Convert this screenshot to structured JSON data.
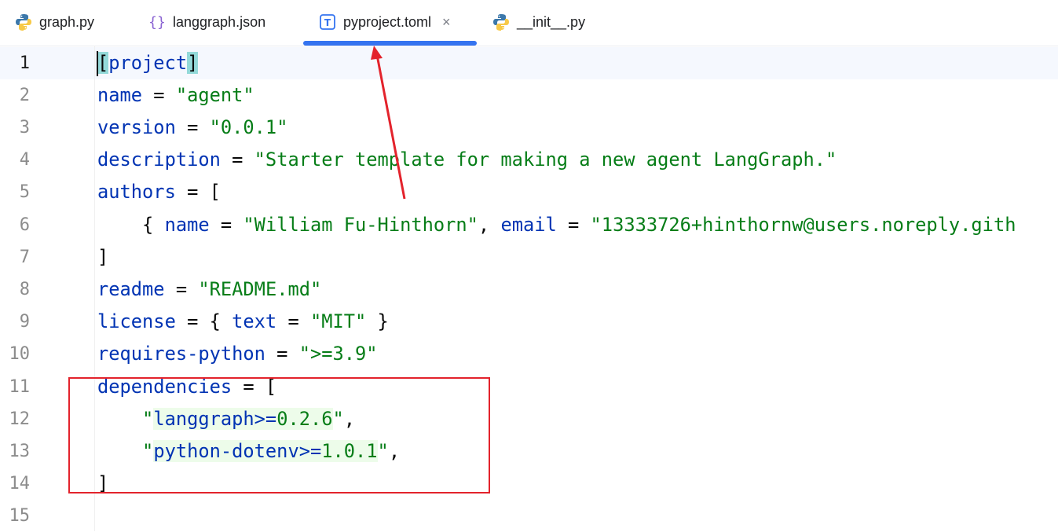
{
  "tabs": [
    {
      "label": "graph.py",
      "icon": "python-icon"
    },
    {
      "label": "langgraph.json",
      "icon": "json-braces-icon"
    },
    {
      "label": "pyproject.toml",
      "icon": "toml-file-icon",
      "active": true
    },
    {
      "label": "__init__.py",
      "icon": "python-icon"
    }
  ],
  "tab_close": "×",
  "colors": {
    "accent": "#3574f0",
    "keyword": "#0033b3",
    "string": "#067d17",
    "annotation": "#e3232c",
    "dependency_highlight": "#edfcea",
    "bracket_match": "#93d9d9"
  },
  "editor": {
    "line_numbers": [
      "1",
      "2",
      "3",
      "4",
      "5",
      "6",
      "7",
      "8",
      "9",
      "10",
      "11",
      "12",
      "13",
      "14",
      "15"
    ],
    "lines": [
      [
        {
          "t": "[",
          "c": "p hl-b"
        },
        {
          "t": "project",
          "c": "k"
        },
        {
          "t": "]",
          "c": "p hl-b"
        }
      ],
      [
        {
          "t": "name",
          "c": "k"
        },
        {
          "t": " = ",
          "c": "p"
        },
        {
          "t": "\"agent\"",
          "c": "s"
        }
      ],
      [
        {
          "t": "version",
          "c": "k"
        },
        {
          "t": " = ",
          "c": "p"
        },
        {
          "t": "\"0.0.1\"",
          "c": "s"
        }
      ],
      [
        {
          "t": "description",
          "c": "k"
        },
        {
          "t": " = ",
          "c": "p"
        },
        {
          "t": "\"Starter template for making a new agent LangGraph.\"",
          "c": "s"
        }
      ],
      [
        {
          "t": "authors",
          "c": "k"
        },
        {
          "t": " = [",
          "c": "p"
        }
      ],
      [
        {
          "t": "    { ",
          "c": "p"
        },
        {
          "t": "name",
          "c": "k"
        },
        {
          "t": " = ",
          "c": "p"
        },
        {
          "t": "\"William Fu-Hinthorn\"",
          "c": "s"
        },
        {
          "t": ", ",
          "c": "p"
        },
        {
          "t": "email",
          "c": "k"
        },
        {
          "t": " = ",
          "c": "p"
        },
        {
          "t": "\"13333726+hinthornw@users.noreply.gith",
          "c": "s"
        }
      ],
      [
        {
          "t": "]",
          "c": "p"
        }
      ],
      [
        {
          "t": "readme",
          "c": "k"
        },
        {
          "t": " = ",
          "c": "p"
        },
        {
          "t": "\"README.md\"",
          "c": "s"
        }
      ],
      [
        {
          "t": "license",
          "c": "k"
        },
        {
          "t": " = { ",
          "c": "p"
        },
        {
          "t": "text",
          "c": "k"
        },
        {
          "t": " = ",
          "c": "p"
        },
        {
          "t": "\"MIT\"",
          "c": "s"
        },
        {
          "t": " }",
          "c": "p"
        }
      ],
      [
        {
          "t": "requires-python",
          "c": "k"
        },
        {
          "t": " = ",
          "c": "p"
        },
        {
          "t": "\">=3.9\"",
          "c": "s"
        }
      ],
      [
        {
          "t": "dependencies",
          "c": "k"
        },
        {
          "t": " = [",
          "c": "p"
        }
      ],
      [
        {
          "t": "    ",
          "c": "p"
        },
        {
          "t": "\"",
          "c": "s"
        },
        {
          "t": "langgraph>=",
          "c": "k hl"
        },
        {
          "t": "0.2.6",
          "c": "s hl"
        },
        {
          "t": "\"",
          "c": "s"
        },
        {
          "t": ",",
          "c": "p"
        }
      ],
      [
        {
          "t": "    ",
          "c": "p"
        },
        {
          "t": "\"",
          "c": "s"
        },
        {
          "t": "python-dotenv>=",
          "c": "k hl"
        },
        {
          "t": "1.0.1",
          "c": "s hl"
        },
        {
          "t": "\"",
          "c": "s"
        },
        {
          "t": ",",
          "c": "p"
        }
      ],
      [
        {
          "t": "]",
          "c": "p"
        }
      ],
      []
    ]
  }
}
